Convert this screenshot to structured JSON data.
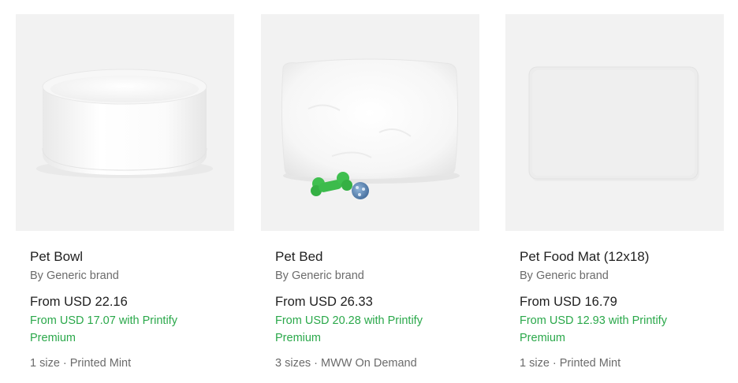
{
  "products": [
    {
      "title": "Pet Bowl",
      "brand": "By Generic brand",
      "price": "From USD 22.16",
      "premium_price": "From USD 17.07 with Printify Premium",
      "meta": "1 size · Printed Mint",
      "image": "pet-bowl-image"
    },
    {
      "title": "Pet Bed",
      "brand": "By Generic brand",
      "price": "From USD 26.33",
      "premium_price": "From USD 20.28 with Printify Premium",
      "meta": "3 sizes · MWW On Demand",
      "image": "pet-bed-image"
    },
    {
      "title": "Pet Food Mat (12x18)",
      "brand": "By Generic brand",
      "price": "From USD 16.79",
      "premium_price": "From USD 12.93 with Printify Premium",
      "meta": "1 size · Printed Mint",
      "image": "pet-food-mat-image"
    }
  ],
  "colors": {
    "premium_green": "#2aa84a",
    "thumbnail_bg": "#f2f2f2"
  }
}
